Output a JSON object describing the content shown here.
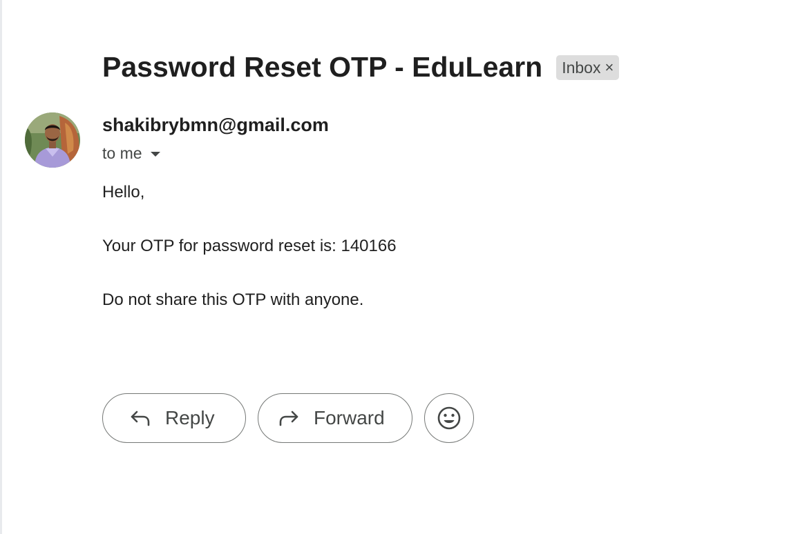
{
  "email": {
    "subject": "Password Reset OTP - EduLearn",
    "label": {
      "text": "Inbox",
      "remove_icon": "close-icon"
    },
    "sender": {
      "address": "shakibrybmn@gmail.com",
      "avatar_icon": "avatar-photo"
    },
    "recipient": {
      "text": "to me",
      "toggle_icon": "caret-down-icon"
    },
    "body": {
      "greeting": "Hello,",
      "otp_line": "Your OTP for password reset is: 140166",
      "warning": "Do not share this OTP with anyone."
    }
  },
  "actions": {
    "reply_label": "Reply",
    "reply_icon": "reply-arrow-icon",
    "forward_label": "Forward",
    "forward_icon": "forward-arrow-icon",
    "emoji_icon": "smiley-face-icon"
  },
  "colors": {
    "text_primary": "#1f1f1f",
    "text_secondary": "#444746",
    "chip_background": "#dddddd",
    "button_border": "#747775"
  }
}
